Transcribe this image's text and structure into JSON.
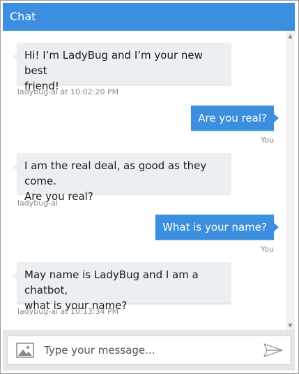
{
  "header": {
    "title": "Chat"
  },
  "messages": [
    {
      "from": "bot",
      "lines": [
        "Hi! I’m LadyBug and I’m your new best",
        "friend!"
      ],
      "meta": "ladybug-ai at 10:02:20 PM"
    },
    {
      "from": "user",
      "text": "Are you real?",
      "meta": "You"
    },
    {
      "from": "bot",
      "lines": [
        "I am the real deal, as good as they come.",
        "Are you real?"
      ],
      "meta": "ladybug-ai"
    },
    {
      "from": "user",
      "text": "What is your name?",
      "meta": "You"
    },
    {
      "from": "bot",
      "lines": [
        "May name is LadyBug and I am a chatbot,",
        "what is your name?"
      ],
      "meta": "ladybug-ai at 10:13:34 PM"
    }
  ],
  "composer": {
    "placeholder": "Type your message...",
    "upload_icon": "image-icon",
    "send_icon": "send-icon"
  },
  "colors": {
    "accent": "#3b8fde",
    "bot_bubble": "#eceff1",
    "footer": "#e6e6e6"
  }
}
